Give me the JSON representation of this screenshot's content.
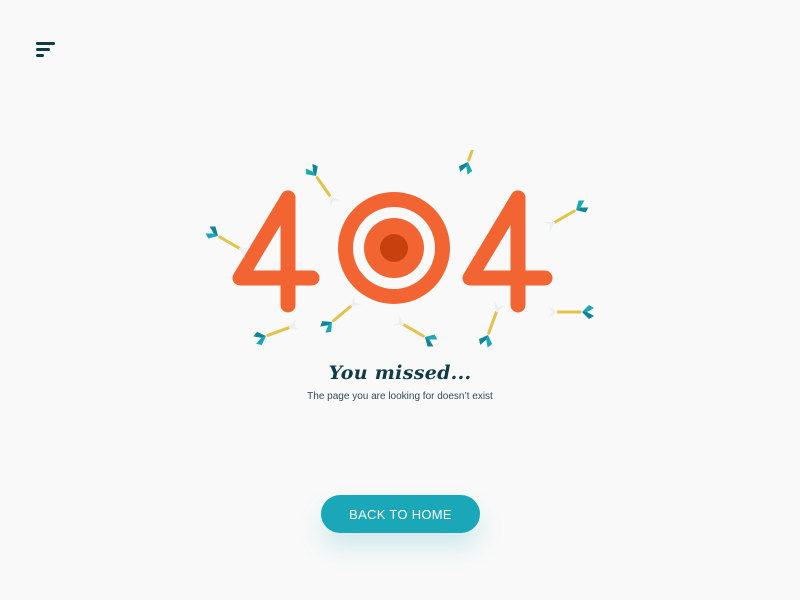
{
  "header": {
    "menu_icon": "hamburger-menu-icon"
  },
  "hero": {
    "code_digits": [
      "4",
      "0",
      "4"
    ],
    "illustration": "target-with-darts",
    "colors": {
      "digits": "#f26532",
      "target_center": "#c9400f",
      "dart_fletching": "#1aa7b8",
      "dart_shaft": "#e3c24a"
    }
  },
  "message": {
    "headline": "You missed...",
    "subtext": "The page you are looking for doesn’t exist"
  },
  "actions": {
    "back_home_label": "BACK TO HOME",
    "button_color": "#1aa7b8"
  },
  "colors": {
    "background": "#f9f9f9",
    "headline_text": "#0f3a4a",
    "body_text": "#334b55"
  }
}
